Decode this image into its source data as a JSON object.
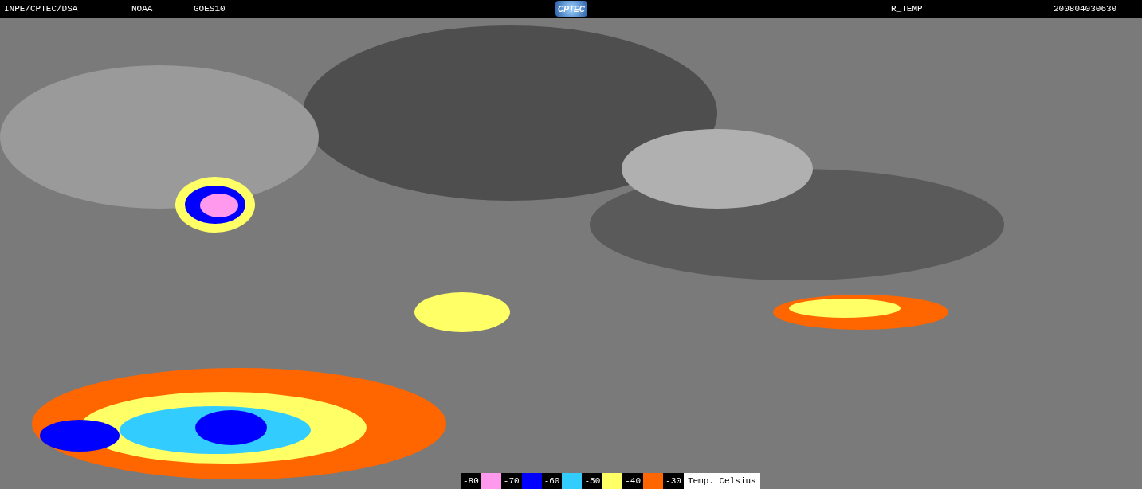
{
  "header": {
    "source": "INPE/CPTEC/DSA",
    "agency": "NOAA",
    "satellite": "GOES10",
    "logo": "CPTEC",
    "product": "R_TEMP",
    "timestamp": "200804030630"
  },
  "legend": {
    "entries": [
      {
        "label": "-80",
        "color": "#ff99ee"
      },
      {
        "label": "-70",
        "color": "#0000ff"
      },
      {
        "label": "-60",
        "color": "#33ccff"
      },
      {
        "label": "-50",
        "color": "#ffff66"
      },
      {
        "label": "-40",
        "color": "#ff6600"
      },
      {
        "label": "-30"
      }
    ],
    "unit": "Temp. Celsius"
  }
}
